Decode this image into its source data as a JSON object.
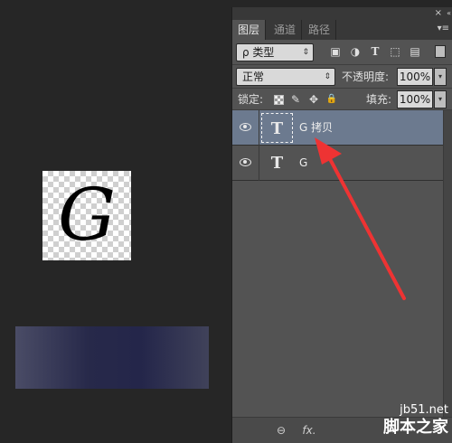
{
  "canvas": {
    "doc_letter": "G"
  },
  "panel": {
    "close_glyph": "×",
    "collapse_glyph": "«",
    "tabs": [
      {
        "label": "图层",
        "active": true
      },
      {
        "label": "通道",
        "active": false
      },
      {
        "label": "路径",
        "active": false
      }
    ],
    "menu_glyph": "▾≡",
    "filter": {
      "kind_label": "ρ 类型",
      "icons": [
        "image-filter-icon",
        "adjustment-filter-icon",
        "type-filter-icon",
        "shape-filter-icon",
        "smart-object-filter-icon"
      ],
      "icon_glyphs": [
        "▣",
        "◑",
        "T",
        "⬚",
        "▤"
      ]
    },
    "blend": {
      "mode_value": "正常",
      "opacity_label": "不透明度:",
      "opacity_value": "100%"
    },
    "lock": {
      "label": "锁定:",
      "icon_glyphs": [
        "✎",
        "✥",
        "🔒"
      ],
      "fill_label": "填充:",
      "fill_value": "100%"
    },
    "layers": [
      {
        "name": "G 拷贝",
        "thumb": "T",
        "selected": true,
        "visible": true
      },
      {
        "name": "G",
        "thumb": "T",
        "selected": false,
        "visible": true
      }
    ],
    "footer": {
      "link_glyph": "⊖",
      "fx_glyph": "fx."
    }
  },
  "watermark": {
    "url": "jb51.net",
    "cn": "脚本之家"
  },
  "colors": {
    "annotation_arrow": "#ee3333",
    "selected_layer": "#6c7a8f"
  }
}
